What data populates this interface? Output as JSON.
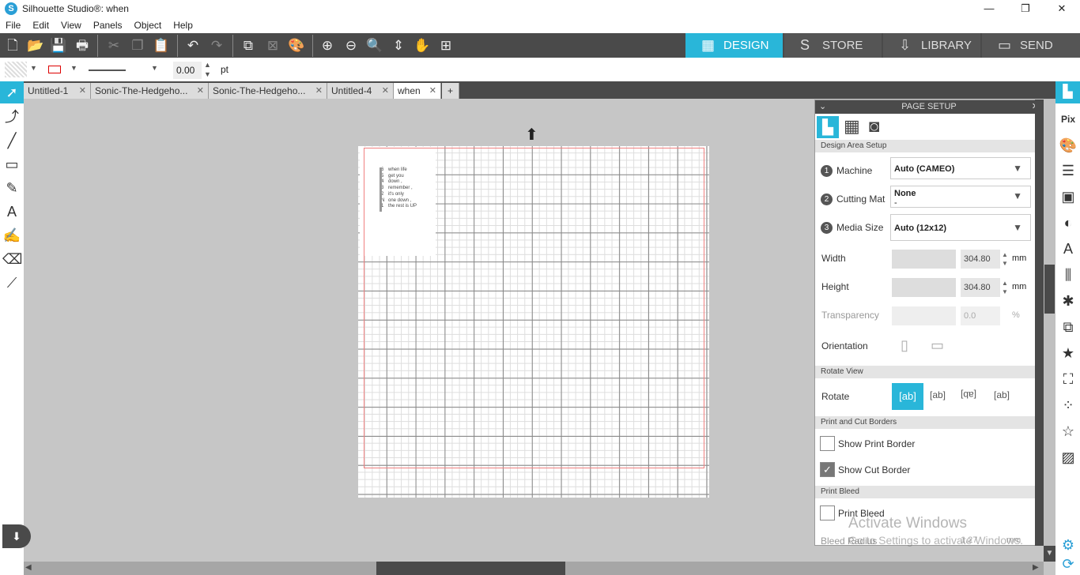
{
  "window": {
    "title": "Silhouette Studio®: when",
    "logo": "S",
    "min": "—",
    "max": "❐",
    "close": "✕"
  },
  "menu": [
    "File",
    "Edit",
    "View",
    "Panels",
    "Object",
    "Help"
  ],
  "nav_tabs": [
    {
      "label": "DESIGN",
      "active": true
    },
    {
      "label": "STORE"
    },
    {
      "label": "LIBRARY"
    },
    {
      "label": "SEND"
    }
  ],
  "line_toolbar": {
    "line_width": "0.00",
    "unit": "pt"
  },
  "doc_tabs": [
    {
      "label": "Untitled-1"
    },
    {
      "label": "Sonic-The-Hedgeho..."
    },
    {
      "label": "Sonic-The-Hedgeho..."
    },
    {
      "label": "Untitled-4"
    },
    {
      "label": "when",
      "active": true
    }
  ],
  "poem": {
    "lines": [
      {
        "n": "6",
        "t": "when life"
      },
      {
        "n": "5",
        "t": "get you"
      },
      {
        "n": "4",
        "t": "down ,"
      },
      {
        "n": "3",
        "t": "remember ,"
      },
      {
        "n": "2",
        "t": "it's only"
      },
      {
        "n": "N",
        "t": "one down ,"
      },
      {
        "n": "1",
        "t": "the rest is UP"
      }
    ]
  },
  "panel": {
    "title": "PAGE SETUP",
    "design_area": "Design Area Setup",
    "machine_label": "Machine",
    "machine": "Auto (CAMEO)",
    "mat_label": "Cutting Mat",
    "mat": "None",
    "mat_sub": "-",
    "media_label": "Media Size",
    "media": "Auto (12x12)",
    "width_label": "Width",
    "width": "304.80",
    "height_label": "Height",
    "height": "304.80",
    "unit": "mm",
    "transparency_label": "Transparency",
    "transparency": "0.0",
    "pct": "%",
    "orientation_label": "Orientation",
    "rotate_view": "Rotate View",
    "rotate_label": "Rotate",
    "borders": "Print and Cut Borders",
    "show_print": "Show Print Border",
    "show_print_checked": false,
    "show_cut": "Show Cut Border",
    "show_cut_checked": true,
    "bleed": "Print Bleed",
    "print_bleed": "Print Bleed",
    "print_bleed_checked": false,
    "bleed_radius": "Bleed Radius",
    "bleed_value": "1.27"
  },
  "watermark": {
    "line1": "Activate Windows",
    "line2": "Go to Settings to activate Windows."
  },
  "colors": {
    "accent": "#29b6d9",
    "toolbar": "#4a4a4a",
    "canvas": "#c6c6c6"
  }
}
